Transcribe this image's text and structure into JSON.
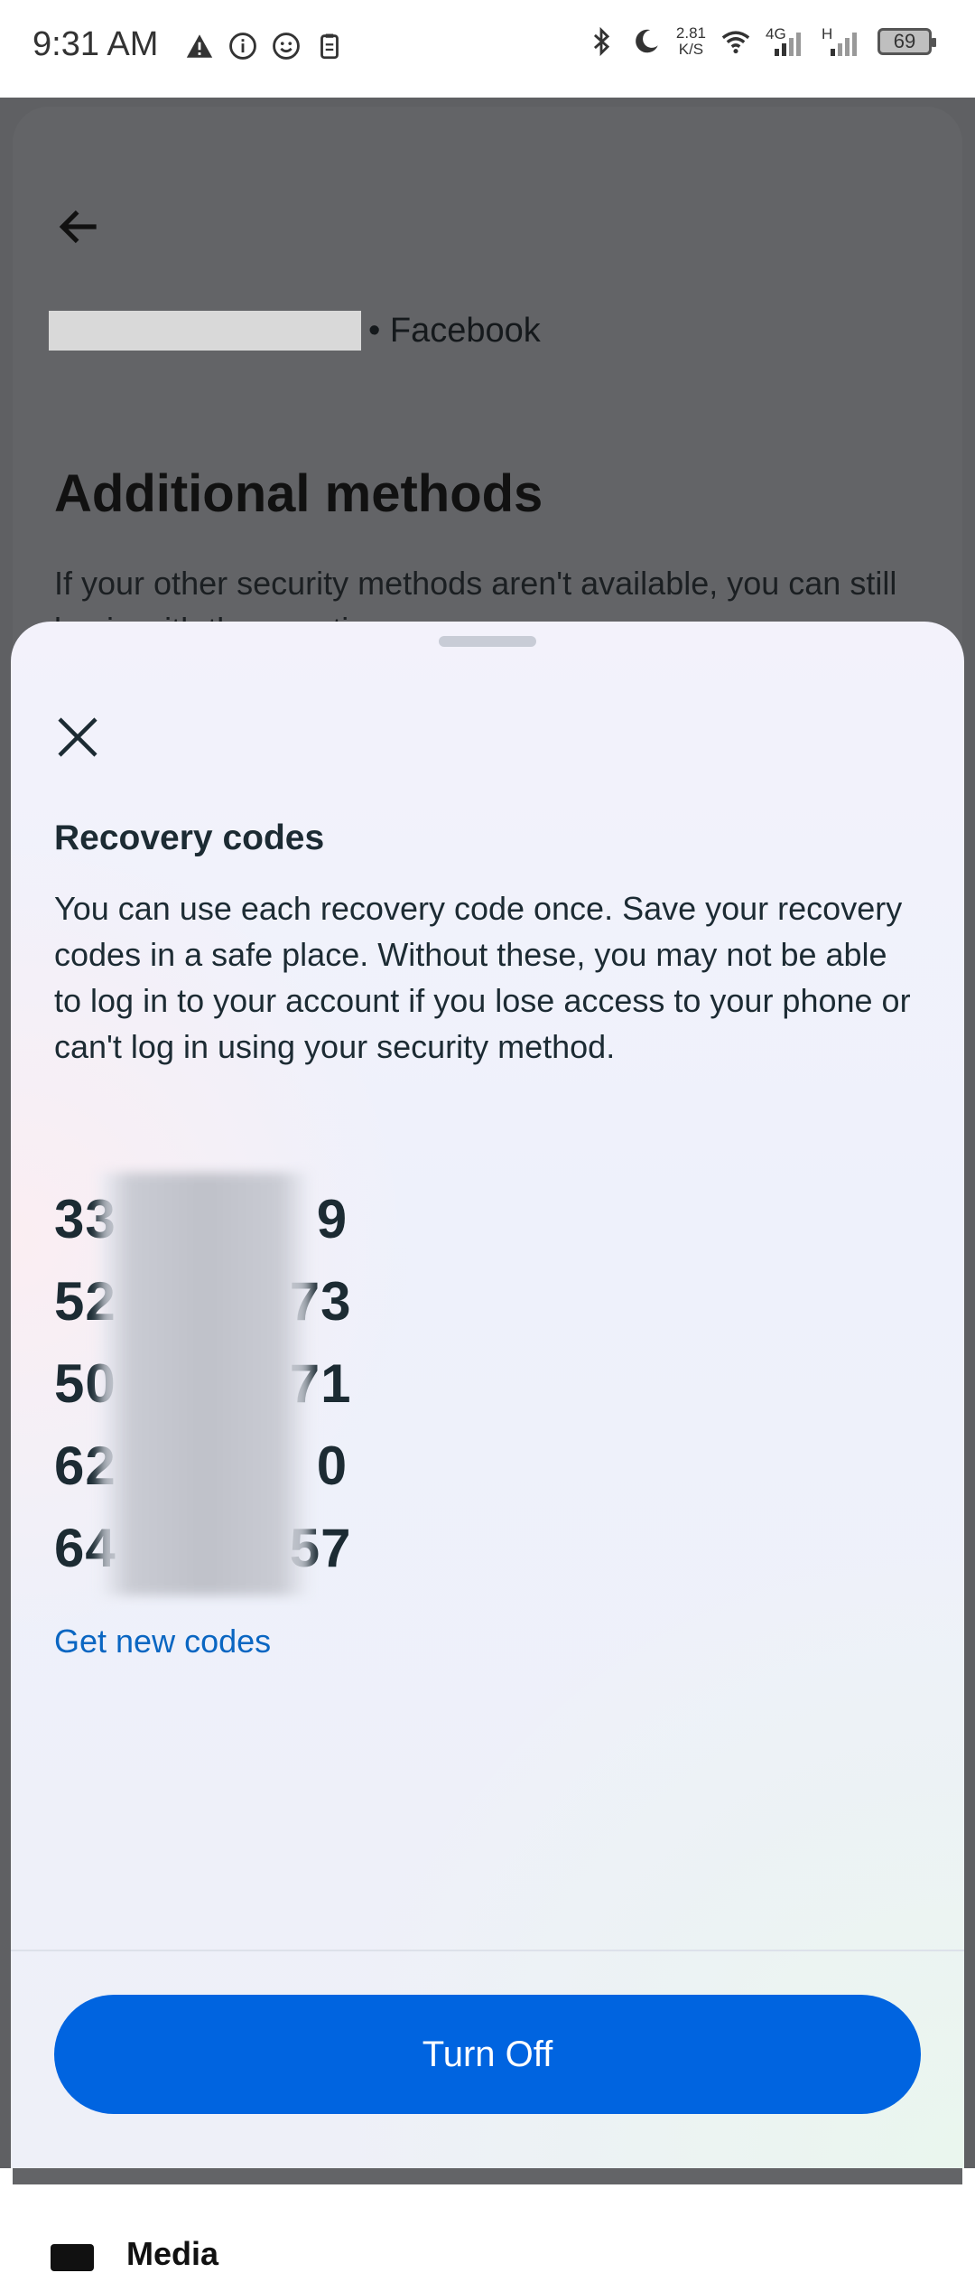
{
  "status_bar": {
    "time": "9:31 AM",
    "left_icons": [
      "warning-icon",
      "info-icon",
      "smiley-icon",
      "clipboard-icon"
    ],
    "right_icons": [
      "bluetooth-icon",
      "moon-icon",
      "wifi-icon",
      "signal-4g-icon",
      "signal-h-icon"
    ],
    "net_speed_value": "2.81",
    "net_speed_unit": "K/S",
    "network_4g": "4G",
    "network_h": "H",
    "battery": "69"
  },
  "background_page": {
    "platform": "• Facebook",
    "title": "Additional methods",
    "description": "If your other security methods aren't available, you can still log in with these options.",
    "peek_item": "Media"
  },
  "sheet": {
    "title": "Recovery codes",
    "description": "You can use each recovery code once. Save your recovery codes in a safe place. Without these, you may not be able to log in to your account if you lose access to your phone or can't log in using your security method.",
    "codes": [
      {
        "prefix": "33",
        "suffix": "9"
      },
      {
        "prefix": "52",
        "suffix": "73"
      },
      {
        "prefix": "50",
        "suffix": "71"
      },
      {
        "prefix": "62",
        "suffix": "0"
      },
      {
        "prefix": "64",
        "suffix": "57"
      }
    ],
    "get_new_codes_label": "Get new codes",
    "primary_button_label": "Turn Off"
  },
  "colors": {
    "accent": "#0064e0",
    "link": "#0a66c2",
    "text": "#1c2b33",
    "overlay": "#5f6063"
  }
}
